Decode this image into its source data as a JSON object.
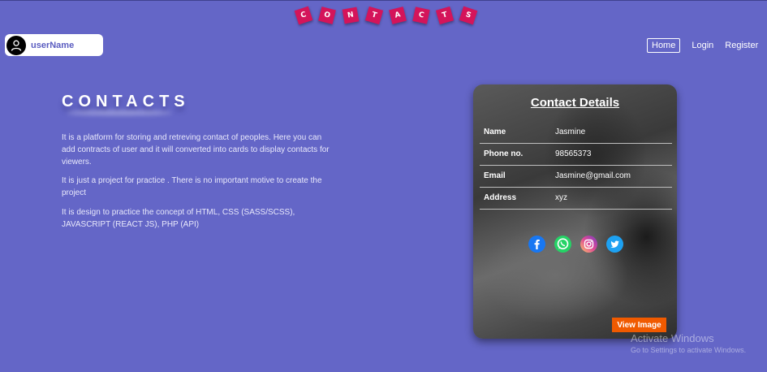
{
  "logo": {
    "letters": [
      "C",
      "O",
      "N",
      "T",
      "A",
      "C",
      "T",
      "S"
    ]
  },
  "user": {
    "name": "userName"
  },
  "nav": {
    "home": "Home",
    "login": "Login",
    "register": "Register"
  },
  "hero": {
    "title": "CONTACTS",
    "paragraphs": [
      "It is a platform for storing and retreving contact of peoples. Here you can add contracts of user and it will converted into cards to display contacts for viewers.",
      "It is just a project for practice . There is no important motive to create the project",
      "It is design to practice the concept of HTML, CSS (SASS/SCSS), JAVASCRIPT (REACT JS), PHP (API)"
    ]
  },
  "card": {
    "title": "Contact Details",
    "rows": [
      {
        "label": "Name",
        "value": "Jasmine"
      },
      {
        "label": "Phone no.",
        "value": "98565373"
      },
      {
        "label": "Email",
        "value": "Jasmine@gmail.com"
      },
      {
        "label": "Address",
        "value": "xyz"
      }
    ],
    "socials": [
      "facebook-icon",
      "whatsapp-icon",
      "instagram-icon",
      "twitter-icon"
    ],
    "view_button": "View Image"
  },
  "watermark": {
    "title": "Activate Windows",
    "subtitle": "Go to Settings to activate Windows."
  },
  "colors": {
    "background": "#6466c7",
    "logo_tile": "#d4145a",
    "view_button": "#f05a00"
  }
}
